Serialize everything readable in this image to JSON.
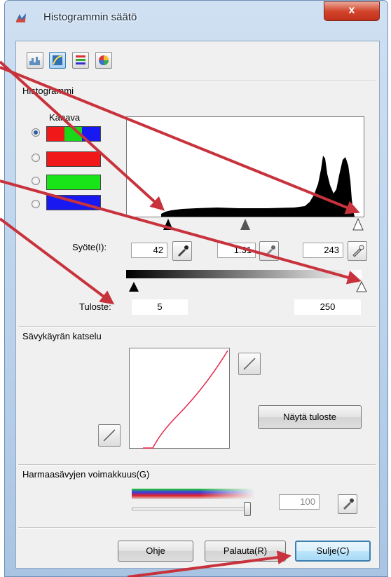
{
  "window": {
    "title": "Histogrammin säätö",
    "close_label": "x"
  },
  "toolbar": {
    "icons": [
      "histogram-icon",
      "curve-icon",
      "levels-icon",
      "color-balance-icon"
    ]
  },
  "histogram": {
    "group_label": "Histogrammi",
    "channel_label": "Kanava",
    "channels": [
      "rgb",
      "red",
      "green",
      "blue"
    ],
    "selected_channel": 0
  },
  "input": {
    "label": "Syöte(I):",
    "black": "42",
    "gamma": "1.31",
    "white": "243"
  },
  "output": {
    "label": "Tuloste:",
    "black": "5",
    "white": "250"
  },
  "curve": {
    "group_label": "Sävykäyrän katselu",
    "show_output_button": "Näytä tuloste"
  },
  "gray": {
    "group_label": "Harmaasävyjen voimakkuus(G)",
    "value": "100",
    "slider_level": 1.0
  },
  "buttons": {
    "help": "Ohje",
    "reset": "Palauta(R)",
    "close": "Sulje(C)"
  },
  "colors": {
    "annotation": "#c8323c",
    "curve": "#e8244a"
  }
}
